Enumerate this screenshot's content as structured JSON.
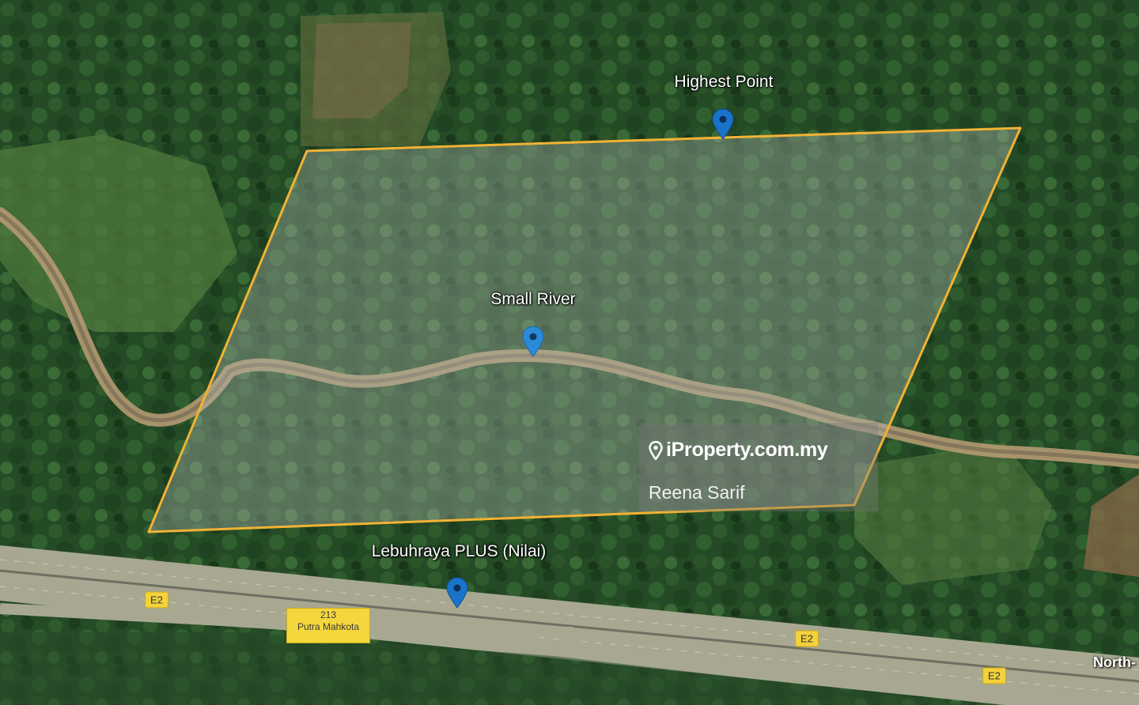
{
  "map": {
    "type": "satellite",
    "boundary_color": "#f2b233",
    "markers": [
      {
        "name": "highest-point",
        "label": "Highest Point",
        "color": "#1a73c8"
      },
      {
        "name": "small-river",
        "label": "Small River",
        "color": "#2a8ad8"
      },
      {
        "name": "lebuhraya-plus",
        "label": "Lebuhraya PLUS (Nilai)",
        "color": "#1a73c8"
      }
    ],
    "road_shields": [
      "E2",
      "E2",
      "E2"
    ],
    "exit_sign": {
      "number": "213",
      "name": "Putra Mahkota"
    },
    "road_name": "North-"
  },
  "watermark": {
    "brand": "iProperty.com.my",
    "author": "Reena Sarif",
    "icon": "location-pin-icon"
  }
}
